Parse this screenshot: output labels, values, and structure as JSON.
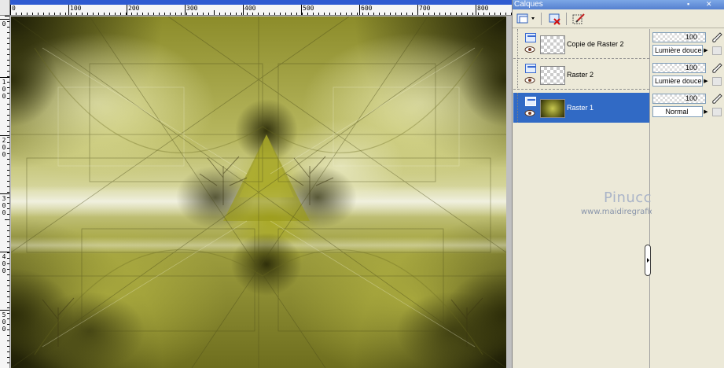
{
  "palette": {
    "title": "Calques",
    "title_buttons": [
      "▪",
      "✕"
    ]
  },
  "ruler": {
    "top_labels": [
      "0",
      "100",
      "200",
      "300",
      "400",
      "500",
      "600",
      "700",
      "800"
    ],
    "left_labels": [
      "0",
      "1\n0\n0",
      "2\n0\n0",
      "3\n0\n0",
      "4\n0\n0",
      "5\n0\n0"
    ]
  },
  "layers": [
    {
      "name": "Copie de Raster 2",
      "opacity": "100",
      "blend_mode": "Lumière douce",
      "selected": false,
      "thumbnail": "transparent"
    },
    {
      "name": "Raster 2",
      "opacity": "100",
      "blend_mode": "Lumière douce",
      "selected": false,
      "thumbnail": "transparent"
    },
    {
      "name": "Raster 1",
      "opacity": "100",
      "blend_mode": "Normal",
      "selected": true,
      "thumbnail": "image"
    }
  ],
  "watermark": {
    "name": "Pinuccia",
    "url": "www.maidiregrafica.eu"
  },
  "colors": {
    "selection": "#316ac5",
    "title_bar": "#5580d0",
    "panel_bg": "#ece9d8",
    "canvas_olive": "#a8a820"
  },
  "icons": {
    "new_layer": "new-raster-layer-icon",
    "delete_layer": "delete-layer-icon",
    "edit_selection": "edit-selection-icon",
    "visibility": "eye-icon",
    "layer_type": "raster-layer-icon",
    "brush": "brush-icon",
    "lock": "lock-icon"
  }
}
